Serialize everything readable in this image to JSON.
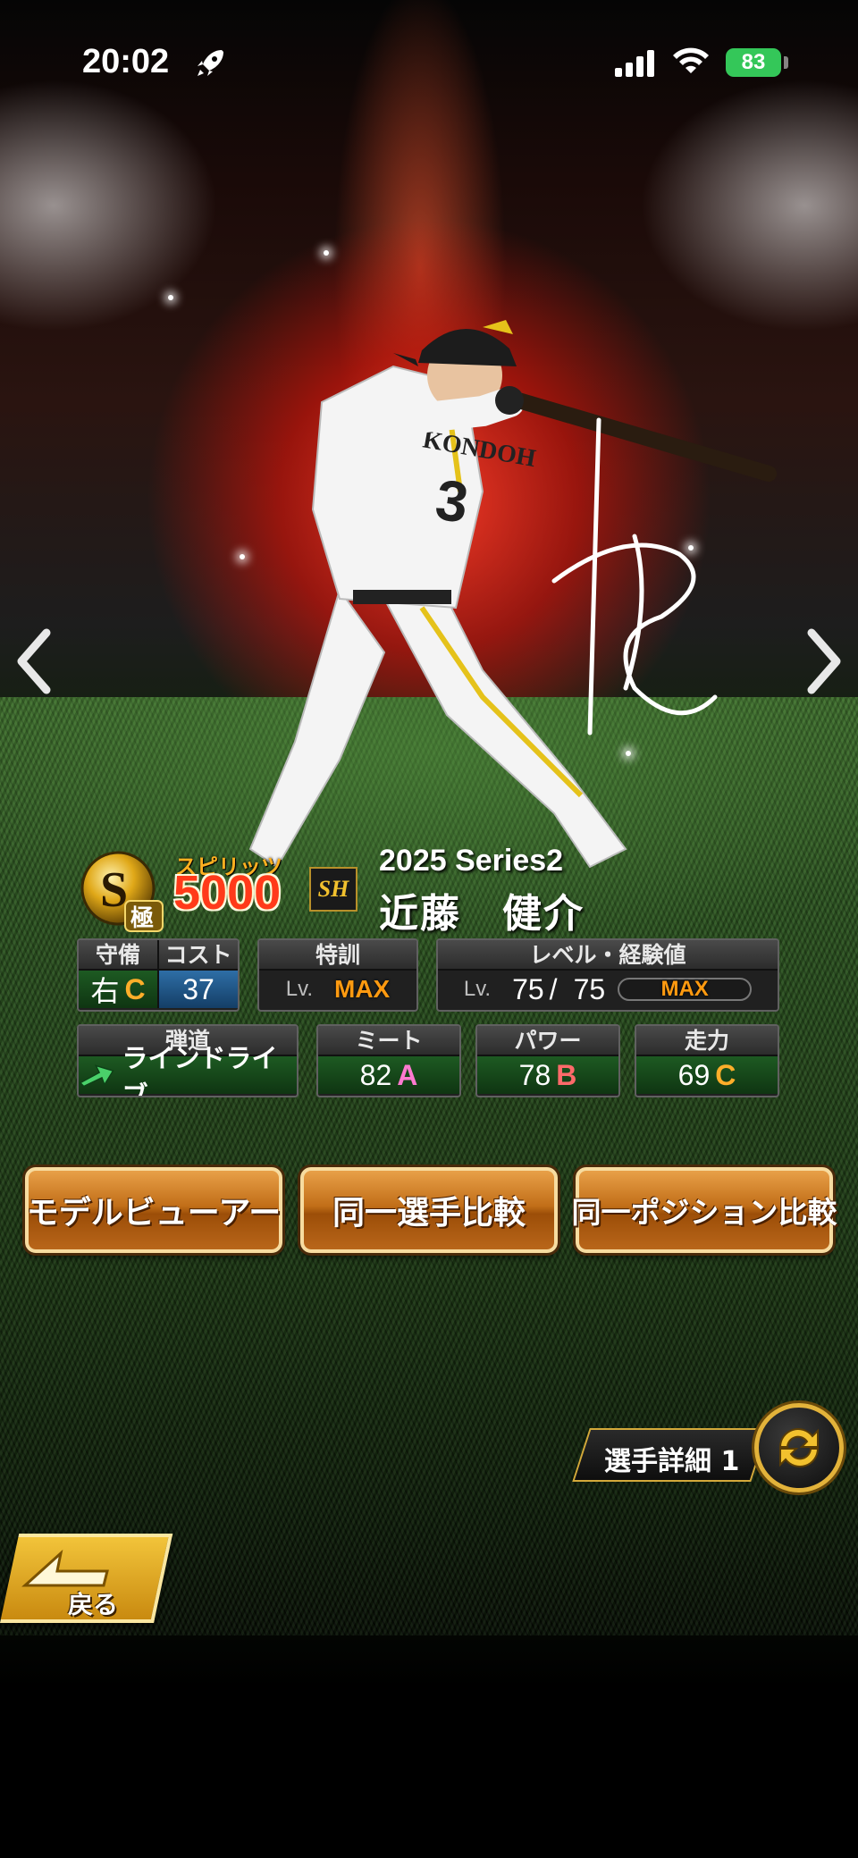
{
  "status_bar": {
    "time": "20:02",
    "battery": "83",
    "icons": [
      "rocket-icon",
      "signal-icon",
      "wifi-icon",
      "battery-icon"
    ]
  },
  "card": {
    "spirits_label": "スピリッツ",
    "spirits_value": "5000",
    "rank_icon": "s-kiwami-rank-badge",
    "team_logo": "SH",
    "series": "2025 Series2",
    "player_name": "近藤　健介",
    "jersey_text": "KONDOH",
    "jersey_number": "3"
  },
  "stats": {
    "defense": {
      "label": "守備",
      "position": "右",
      "grade": "C"
    },
    "cost": {
      "label": "コスト",
      "value": "37"
    },
    "training": {
      "label": "特訓",
      "lv": "Lv.",
      "value": "MAX"
    },
    "level": {
      "label": "レベル・経験値",
      "lv": "Lv.",
      "current": "75",
      "separator": "/",
      "max": "75",
      "exp_text": "MAX"
    },
    "trajectory": {
      "label": "弾道",
      "value": "ラインドライブ"
    },
    "meet": {
      "label": "ミート",
      "value": "82",
      "grade": "A"
    },
    "power": {
      "label": "パワー",
      "value": "78",
      "grade": "B"
    },
    "speed": {
      "label": "走力",
      "value": "69",
      "grade": "C"
    }
  },
  "actions": {
    "model_viewer": "モデルビューアー",
    "same_player_compare": "同一選手比較",
    "same_position_compare": "同一ポジション比較"
  },
  "detail": {
    "label": "選手詳細 1"
  },
  "back": {
    "label": "戻る"
  },
  "colors": {
    "accent_gold": "#e3b33a",
    "button_orange": "#c16e18",
    "grade_a": "#ff7ad0",
    "grade_b": "#ff6a6a",
    "grade_c": "#ffae2a",
    "max_orange": "#ff9a10"
  }
}
